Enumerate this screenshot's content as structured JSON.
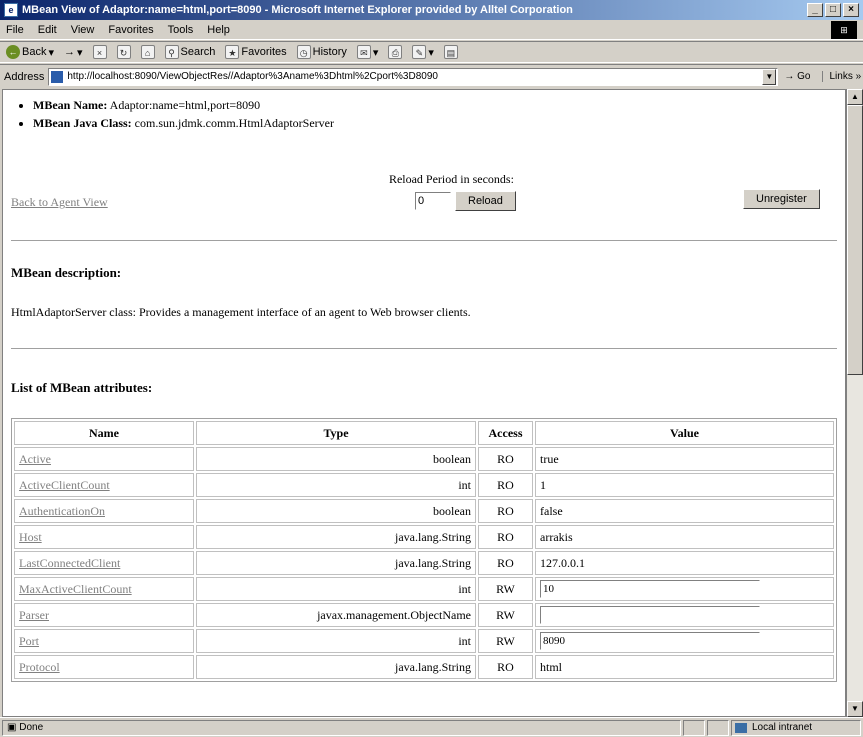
{
  "window": {
    "title": "MBean View of Adaptor:name=html,port=8090 - Microsoft Internet Explorer provided by Alltel Corporation",
    "controls": [
      "_",
      "□",
      "×"
    ]
  },
  "menu": [
    "File",
    "Edit",
    "View",
    "Favorites",
    "Tools",
    "Help"
  ],
  "toolbar": {
    "back": "Back",
    "forward": "→",
    "search": "Search",
    "favorites": "Favorites",
    "history": "History"
  },
  "address": {
    "label": "Address",
    "url": "http://localhost:8090/ViewObjectRes//Adaptor%3Aname%3Dhtml%2Cport%3D8090",
    "go": "Go",
    "links": "Links"
  },
  "mbean": {
    "name_label": "MBean Name:",
    "name_value": "Adaptor:name=html,port=8090",
    "class_label": "MBean Java Class:",
    "class_value": "com.sun.jdmk.comm.HtmlAdaptorServer"
  },
  "controls": {
    "back_link": "Back to Agent View",
    "reload_label": "Reload Period in seconds:",
    "reload_value": "0",
    "reload_button": "Reload",
    "unregister_button": "Unregister"
  },
  "description": {
    "heading": "MBean description:",
    "text": "HtmlAdaptorServer class: Provides a management interface of an agent to Web browser clients."
  },
  "attributes": {
    "heading": "List of MBean attributes:",
    "columns": [
      "Name",
      "Type",
      "Access",
      "Value"
    ],
    "rows": [
      {
        "name": "Active",
        "type": "boolean",
        "access": "RO",
        "value": "true",
        "editable": false
      },
      {
        "name": "ActiveClientCount",
        "type": "int",
        "access": "RO",
        "value": "1",
        "editable": false
      },
      {
        "name": "AuthenticationOn",
        "type": "boolean",
        "access": "RO",
        "value": "false",
        "editable": false
      },
      {
        "name": "Host",
        "type": "java.lang.String",
        "access": "RO",
        "value": "arrakis",
        "editable": false
      },
      {
        "name": "LastConnectedClient",
        "type": "java.lang.String",
        "access": "RO",
        "value": "127.0.0.1",
        "editable": false
      },
      {
        "name": "MaxActiveClientCount",
        "type": "int",
        "access": "RW",
        "value": "10",
        "editable": true
      },
      {
        "name": "Parser",
        "type": "javax.management.ObjectName",
        "access": "RW",
        "value": "",
        "editable": true
      },
      {
        "name": "Port",
        "type": "int",
        "access": "RW",
        "value": "8090",
        "editable": true
      },
      {
        "name": "Protocol",
        "type": "java.lang.String",
        "access": "RO",
        "value": "html",
        "editable": false
      }
    ]
  },
  "status": {
    "text": "Done",
    "zone": "Local intranet"
  }
}
